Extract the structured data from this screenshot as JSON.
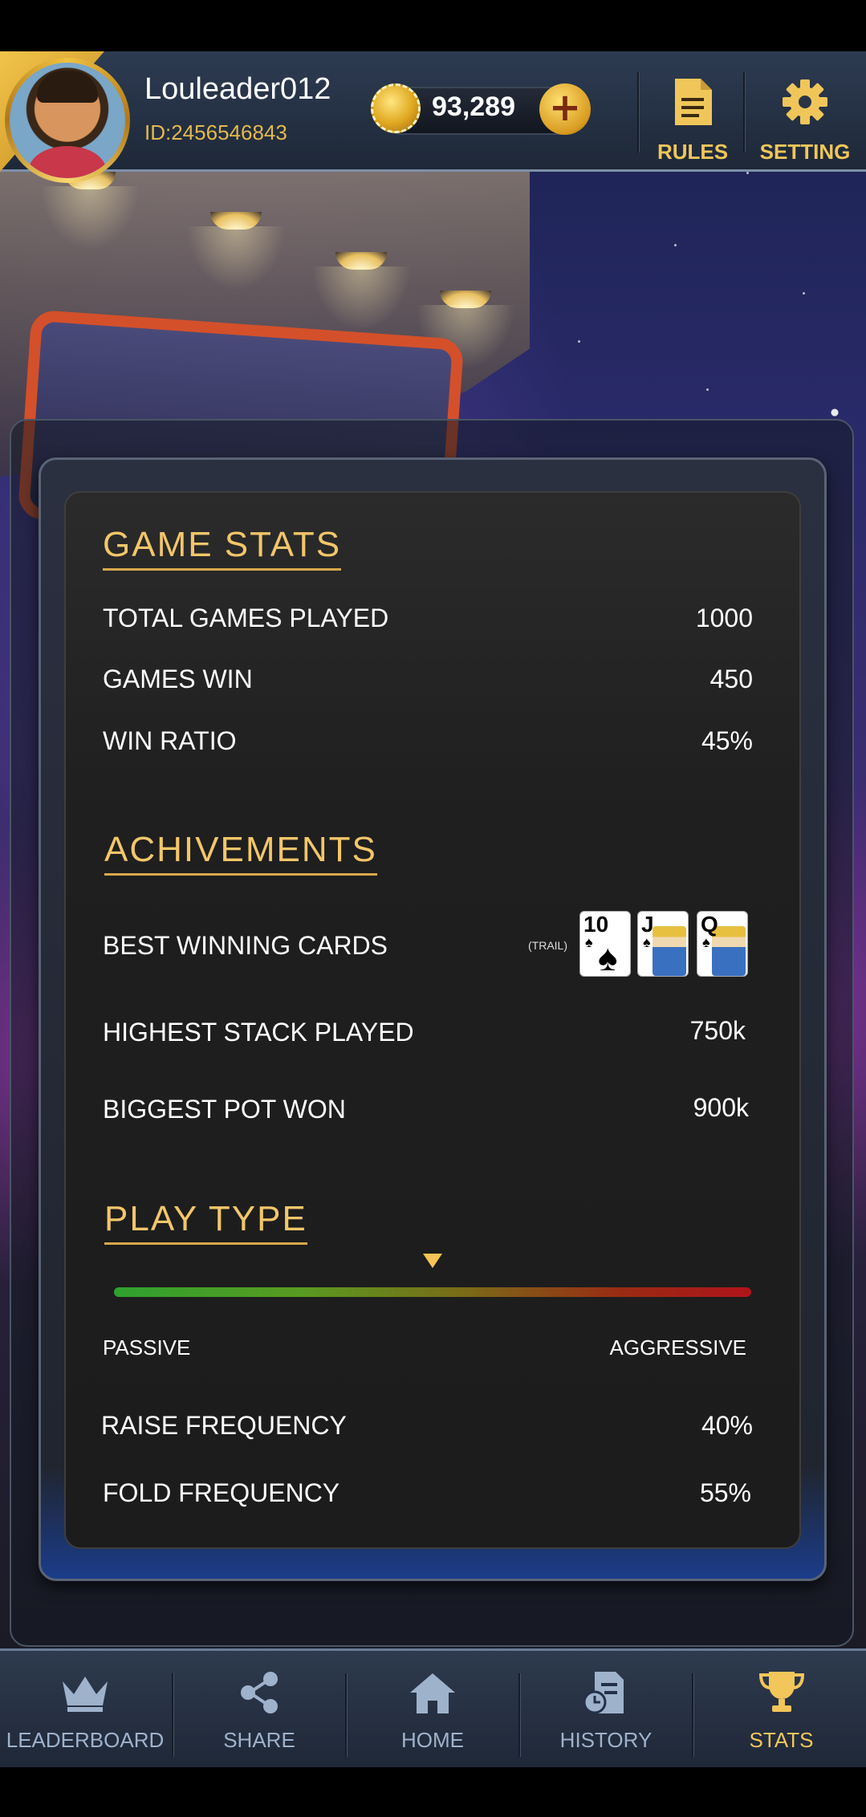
{
  "header": {
    "username": "Louleader012",
    "user_id": "ID:2456546843",
    "coin_balance": "93,289",
    "rules_label": "RULES",
    "setting_label": "SETTING"
  },
  "game_stats": {
    "title": "GAME STATS",
    "rows": [
      {
        "label": "TOTAL GAMES PLAYED",
        "value": "1000"
      },
      {
        "label": "GAMES WIN",
        "value": "450"
      },
      {
        "label": "WIN RATIO",
        "value": "45%"
      }
    ]
  },
  "achievements": {
    "title": "ACHIVEMENTS",
    "best_cards_label": "BEST WINNING CARDS",
    "best_cards_type": "(TRAIL)",
    "cards": [
      {
        "rank": "10",
        "suit": "♠"
      },
      {
        "rank": "J",
        "suit": "♠"
      },
      {
        "rank": "Q",
        "suit": "♠"
      }
    ],
    "rows": [
      {
        "label": "HIGHEST STACK PLAYED",
        "value": "750k"
      },
      {
        "label": "BIGGEST POT WON",
        "value": "900k"
      }
    ]
  },
  "play_type": {
    "title": "PLAY TYPE",
    "meter_level": 0.5,
    "low_label": "PASSIVE",
    "high_label": "AGGRESSIVE",
    "rows": [
      {
        "label": "RAISE FREQUENCY",
        "value": "40%"
      },
      {
        "label": "FOLD FREQUENCY",
        "value": "55%"
      }
    ]
  },
  "bottom_nav": [
    {
      "label": "LEADERBOARD",
      "icon": "crown-icon"
    },
    {
      "label": "SHARE",
      "icon": "share-icon"
    },
    {
      "label": "HOME",
      "icon": "home-icon"
    },
    {
      "label": "HISTORY",
      "icon": "history-icon"
    },
    {
      "label": "STATS",
      "icon": "trophy-icon",
      "active": true
    }
  ],
  "colors": {
    "accent_gold": "#f2c66a",
    "panel_dark": "#1f1f1f",
    "nav_inactive": "#9fb2cc"
  }
}
